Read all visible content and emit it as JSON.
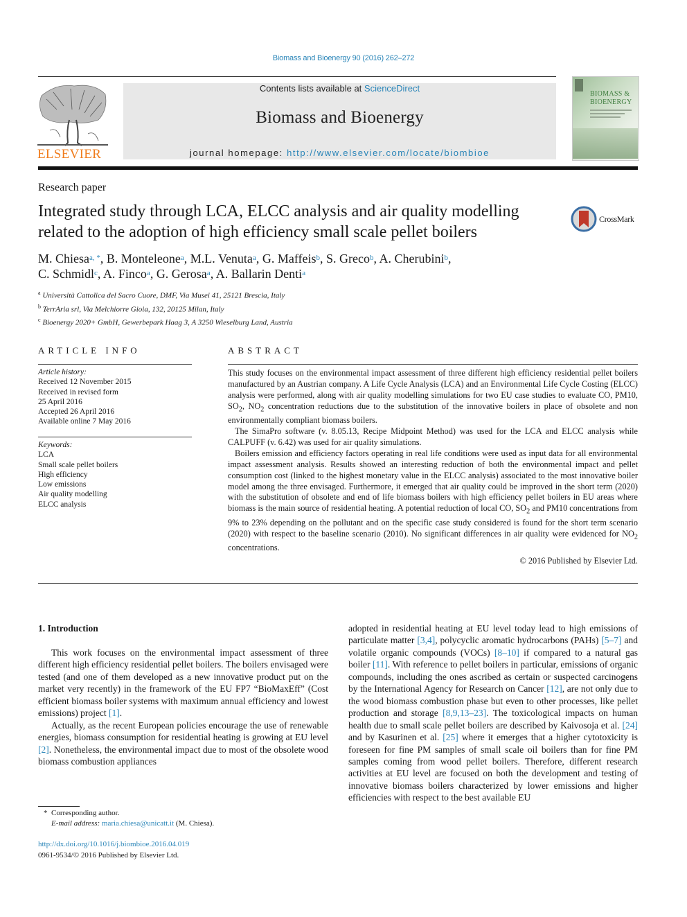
{
  "running_head": "Biomass and Bioenergy 90 (2016) 262–272",
  "masthead": {
    "contents_prefix": "Contents lists available at ",
    "contents_link": "ScienceDirect",
    "journal_name": "Biomass and Bioenergy",
    "homepage_prefix": "journal homepage: ",
    "homepage_url": "http://www.elsevier.com/locate/biombioe",
    "publisher_logo": "ELSEVIER",
    "cover_title_line1": "BIOMASS &",
    "cover_title_line2": "BIOENERGY"
  },
  "article": {
    "type": "Research paper",
    "title": "Integrated study through LCA, ELCC analysis and air quality modelling related to the adoption of high efficiency small scale pellet boilers",
    "crossmark_label": "CrossMark",
    "authors": [
      {
        "name": "M. Chiesa",
        "aff": "a, *",
        "sep": ", "
      },
      {
        "name": "B. Monteleone",
        "aff": "a",
        "sep": ", "
      },
      {
        "name": "M.L. Venuta",
        "aff": "a",
        "sep": ", "
      },
      {
        "name": "G. Maffeis",
        "aff": "b",
        "sep": ", "
      },
      {
        "name": "S. Greco",
        "aff": "b",
        "sep": ", "
      },
      {
        "name": "A. Cherubini",
        "aff": "b",
        "sep": ","
      },
      {
        "name": "C. Schmidl",
        "aff": "c",
        "sep": ", "
      },
      {
        "name": "A. Finco",
        "aff": "a",
        "sep": ", "
      },
      {
        "name": "G. Gerosa",
        "aff": "a",
        "sep": ", "
      },
      {
        "name": "A. Ballarin Denti",
        "aff": "a",
        "sep": ""
      }
    ],
    "affiliations": [
      {
        "key": "a",
        "text": "Università Cattolica del Sacro Cuore, DMF, Via Musei 41, 25121 Brescia, Italy"
      },
      {
        "key": "b",
        "text": "TerrAria srl, Via Melchiorre Gioia, 132, 20125 Milan, Italy"
      },
      {
        "key": "c",
        "text": "Bioenergy 2020+ GmbH, Gewerbepark Haag 3, A 3250 Wieselburg Land, Austria"
      }
    ]
  },
  "article_info": {
    "heading": "ARTICLE INFO",
    "history_label": "Article history:",
    "history": [
      "Received 12 November 2015",
      "Received in revised form",
      "25 April 2016",
      "Accepted 26 April 2016",
      "Available online 7 May 2016"
    ],
    "keywords_label": "Keywords:",
    "keywords": [
      "LCA",
      "Small scale pellet boilers",
      "High efficiency",
      "Low emissions",
      "Air quality modelling",
      "ELCC analysis"
    ]
  },
  "abstract": {
    "heading": "ABSTRACT",
    "p1_a": "This study focuses on the environmental impact assessment of three different high efficiency residential pellet boilers manufactured by an Austrian company. A Life Cycle Analysis (LCA) and an Environmental Life Cycle Costing (ELCC) analysis were performed, along with air quality modelling simulations for two EU case studies to evaluate CO, PM10, SO",
    "p1_b": ", NO",
    "p1_c": " concentration reductions due to the substitution of the innovative boilers in place of obsolete and non environmentally compliant biomass boilers.",
    "p2": "The SimaPro software (v. 8.05.13, Recipe Midpoint Method) was used for the LCA and ELCC analysis while CALPUFF (v. 6.42) was used for air quality simulations.",
    "p3_a": "Boilers emission and efficiency factors operating in real life conditions were used as input data for all environmental impact assessment analysis. Results showed an interesting reduction of both the environmental impact and pellet consumption cost (linked to the highest monetary value in the ELCC analysis) associated to the most innovative boiler model among the three envisaged. Furthermore, it emerged that air quality could be improved in the short term (2020) with the substitution of obsolete and end of life biomass boilers with high efficiency pellet boilers in EU areas where biomass is the main source of residential heating. A potential reduction of local CO, SO",
    "p3_b": " and PM10 concentrations from 9% to 23% depending on the pollutant and on the specific case study considered is found for the short term scenario (2020) with respect to the baseline scenario (2010). No significant differences in air quality were evidenced for NO",
    "p3_c": " concentrations.",
    "subscript": "2",
    "copyright": "© 2016 Published by Elsevier Ltd."
  },
  "introduction": {
    "heading": "1.  Introduction",
    "left_p1_a": "This work focuses on the environmental impact assessment of three different high efficiency residential pellet boilers. The boilers envisaged were tested (and one of them developed as a new innovative product put on the market very recently) in the framework of the EU FP7 “BioMaxEff” (Cost efficient biomass boiler systems with maximum annual efficiency and lowest emissions) project ",
    "ref1": "[1]",
    "left_p1_b": ".",
    "left_p2_a": "Actually, as the recent European policies encourage the use of renewable energies, biomass consumption for residential heating is growing at EU level ",
    "ref2": "[2]",
    "left_p2_b": ". Nonetheless, the environmental impact due to most of the obsolete wood biomass combustion appliances",
    "right_1": "adopted in residential heating at EU level today lead to high emissions of particulate matter ",
    "ref3": "[3,4]",
    "right_2": ", polycyclic aromatic hydrocarbons (PAHs) ",
    "ref4": "[5–7]",
    "right_3": " and volatile organic compounds (VOCs) ",
    "ref5": "[8–10]",
    "right_4": " if compared to a natural gas boiler ",
    "ref6": "[11]",
    "right_5": ". With reference to pellet boilers in particular, emissions of organic compounds, including the ones ascribed as certain or suspected carcinogens by the International Agency for Research on Cancer ",
    "ref7": "[12]",
    "right_6": ", are not only due to the wood biomass combustion phase but even to other processes, like pellet production and storage ",
    "ref8": "[8,9,13–23]",
    "right_7": ". The toxicological impacts on human health due to small scale pellet boilers are described by Kaivosoja et al. ",
    "ref9": "[24]",
    "right_8": " and by Kasurinen et al. ",
    "ref10": "[25]",
    "right_9": " where it emerges that a higher cytotoxicity is foreseen for fine PM samples of small scale oil boilers than for fine PM samples coming from wood pellet boilers. Therefore, different research activities at EU level are focused on both the development and testing of innovative biomass boilers characterized by lower emissions and higher efficiencies with respect to the best available EU"
  },
  "footnotes": {
    "marker": "*",
    "corresponding": "Corresponding author.",
    "email_label": "E-mail address:",
    "email": "maria.chiesa@unicatt.it",
    "email_suffix": " (M. Chiesa)."
  },
  "doi": {
    "url": "http://dx.doi.org/10.1016/j.biombioe.2016.04.019",
    "issn_line": "0961-9534/© 2016 Published by Elsevier Ltd."
  },
  "colors": {
    "link": "#2a85b8",
    "elsevier_orange": "#f07d1e",
    "masthead_bg": "#e8e8e8",
    "crossmark_red": "#c0392b",
    "crossmark_blue": "#3a6ea5"
  }
}
